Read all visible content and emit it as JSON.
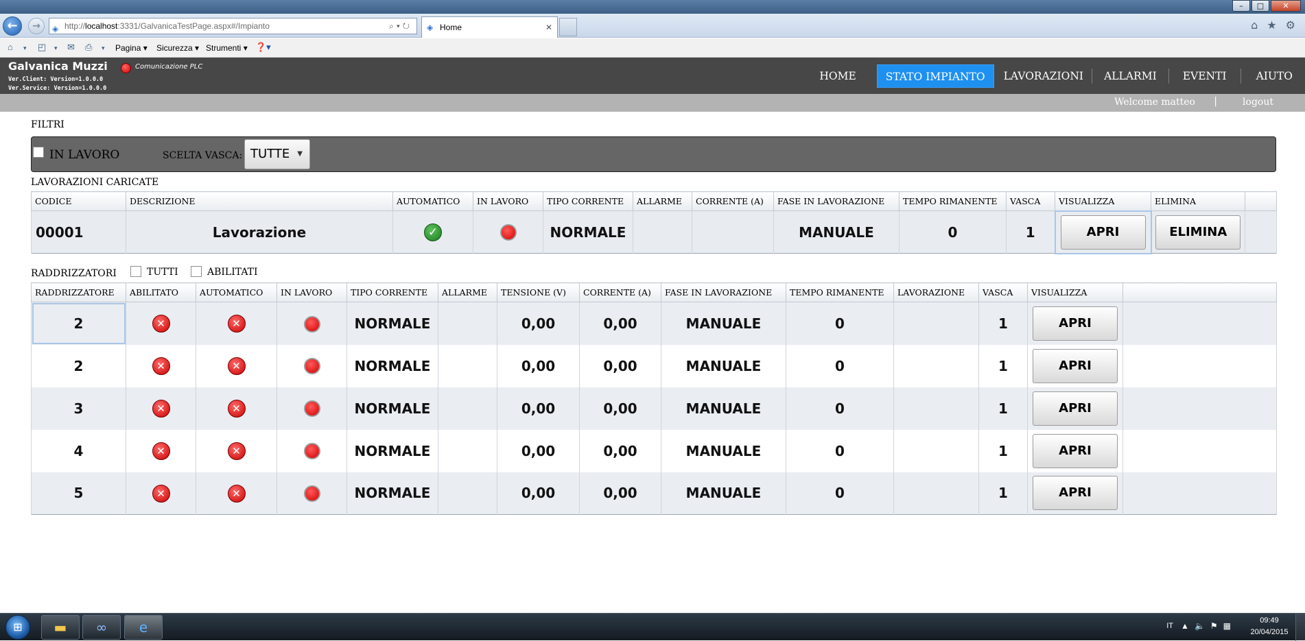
{
  "browser": {
    "url_prefix": "http://",
    "url_host": "localhost",
    "url_rest": ":3331/GalvanicaTestPage.aspx#/Impianto",
    "tab_title": "Home",
    "win_minimize": "–",
    "win_maximize": "□",
    "win_close": "✕",
    "commands": [
      "Pagina",
      "Sicurezza",
      "Strumenti"
    ]
  },
  "app": {
    "title": "Galvanica Muzzi",
    "ver_client": "Ver.Client: Version=1.0.0.0",
    "ver_service": "Ver.Service: Version=1.0.0.0",
    "plc_label": "Comunicazione PLC",
    "nav": [
      "HOME",
      "STATO IMPIANTO",
      "LAVORAZIONI",
      "ALLARMI",
      "EVENTI",
      "AIUTO"
    ],
    "active_nav": "STATO IMPIANTO",
    "welcome": "Welcome matteo",
    "separator": "|",
    "logout": "logout",
    "colors": {
      "header": "#474747",
      "active_nav": "#1e90f0",
      "subbar": "#b3b3b3"
    }
  },
  "filters": {
    "section_label": "FILTRI",
    "in_lavoro_label": "IN LAVORO",
    "in_lavoro_checked": false,
    "vasca_label": "SCELTA VASCA:",
    "vasca_value": "TUTTE"
  },
  "lavorazioni": {
    "section_label": "LAVORAZIONI CARICATE",
    "headers": [
      "CODICE",
      "DESCRIZIONE",
      "AUTOMATICO",
      "IN LAVORO",
      "TIPO CORRENTE",
      "ALLARME",
      "CORRENTE (A)",
      "FASE IN LAVORAZIONE",
      "TEMPO RIMANENTE",
      "VASCA",
      "VISUALIZZA",
      "ELIMINA"
    ],
    "row": {
      "codice": "00001",
      "descrizione": "Lavorazione",
      "automatico": "check-icon",
      "in_lavoro": "red-dot-icon",
      "tipo_corrente": "NORMALE",
      "allarme": "",
      "corrente": "",
      "fase": "MANUALE",
      "tempo": "0",
      "vasca": "1",
      "btn_apri": "APRI",
      "btn_elimina": "ELIMINA"
    }
  },
  "raddrizzatori": {
    "section_label": "RADDRIZZATORI",
    "tutti_label": "TUTTI",
    "abilitati_label": "ABILITATI",
    "headers": [
      "RADDRIZZATORE",
      "ABILITATO",
      "AUTOMATICO",
      "IN LAVORO",
      "TIPO CORRENTE",
      "ALLARME",
      "TENSIONE (V)",
      "CORRENTE (A)",
      "FASE IN LAVORAZIONE",
      "TEMPO RIMANENTE",
      "LAVORAZIONE",
      "VASCA",
      "VISUALIZZA"
    ],
    "rows": [
      {
        "id": "2",
        "tipo": "NORMALE",
        "tensione": "0,00",
        "corrente": "0,00",
        "fase": "MANUALE",
        "tempo": "0",
        "lavorazione": "",
        "vasca": "1",
        "btn": "APRI"
      },
      {
        "id": "2",
        "tipo": "NORMALE",
        "tensione": "0,00",
        "corrente": "0,00",
        "fase": "MANUALE",
        "tempo": "0",
        "lavorazione": "",
        "vasca": "1",
        "btn": "APRI"
      },
      {
        "id": "3",
        "tipo": "NORMALE",
        "tensione": "0,00",
        "corrente": "0,00",
        "fase": "MANUALE",
        "tempo": "0",
        "lavorazione": "",
        "vasca": "1",
        "btn": "APRI"
      },
      {
        "id": "4",
        "tipo": "NORMALE",
        "tensione": "0,00",
        "corrente": "0,00",
        "fase": "MANUALE",
        "tempo": "0",
        "lavorazione": "",
        "vasca": "1",
        "btn": "APRI"
      },
      {
        "id": "5",
        "tipo": "NORMALE",
        "tensione": "0,00",
        "corrente": "0,00",
        "fase": "MANUALE",
        "tempo": "0",
        "lavorazione": "",
        "vasca": "1",
        "btn": "APRI"
      }
    ]
  },
  "taskbar": {
    "lang": "IT",
    "time": "09:49",
    "date": "20/04/2015"
  }
}
